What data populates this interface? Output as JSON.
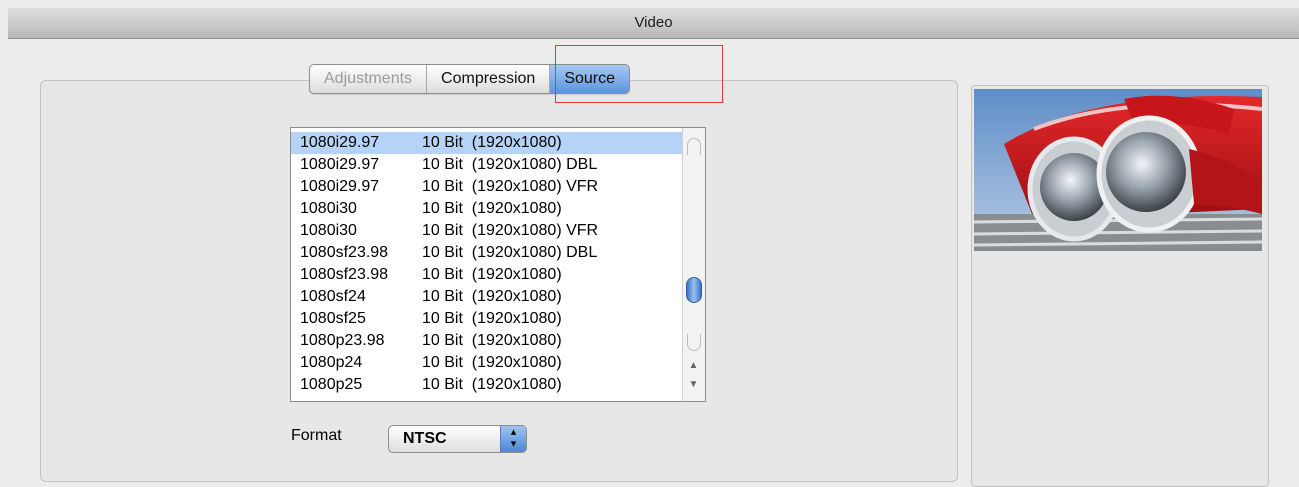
{
  "window": {
    "title": "Video"
  },
  "tabs": [
    {
      "label": "Adjustments",
      "state": "disabled"
    },
    {
      "label": "Compression",
      "state": "normal"
    },
    {
      "label": "Source",
      "state": "selected"
    }
  ],
  "format_list": {
    "selected_index": 0,
    "scroll_position": 0.62,
    "items": [
      {
        "name": "1080i29.97",
        "spec": "10 Bit  (1920x1080)"
      },
      {
        "name": "1080i29.97",
        "spec": "10 Bit  (1920x1080) DBL"
      },
      {
        "name": "1080i29.97",
        "spec": "10 Bit  (1920x1080) VFR"
      },
      {
        "name": "1080i30",
        "spec": "10 Bit  (1920x1080)"
      },
      {
        "name": "1080i30",
        "spec": "10 Bit  (1920x1080) VFR"
      },
      {
        "name": "1080sf23.98",
        "spec": "10 Bit  (1920x1080) DBL"
      },
      {
        "name": "1080sf23.98",
        "spec": "10 Bit  (1920x1080)"
      },
      {
        "name": "1080sf24",
        "spec": "10 Bit  (1920x1080)"
      },
      {
        "name": "1080sf25",
        "spec": "10 Bit  (1920x1080)"
      },
      {
        "name": "1080p23.98",
        "spec": "10 Bit  (1920x1080)"
      },
      {
        "name": "1080p24",
        "spec": "10 Bit  (1920x1080)"
      },
      {
        "name": "1080p25",
        "spec": "10 Bit  (1920x1080)"
      }
    ]
  },
  "format_popup": {
    "label": "Format",
    "value": "NTSC"
  },
  "colors": {
    "selection": "#b5d3f7",
    "active_tab": "#5f95dd",
    "highlight_box": "#e13b3b"
  }
}
